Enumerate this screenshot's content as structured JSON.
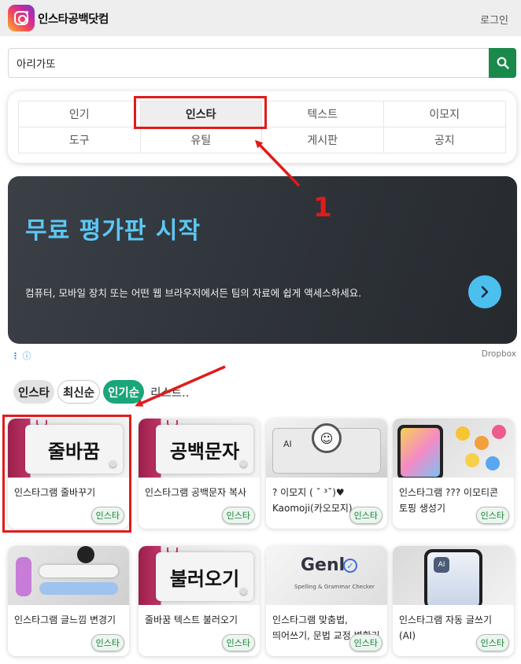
{
  "header": {
    "logo_text": "인스타공백닷컴",
    "login_label": "로그인"
  },
  "search": {
    "value": "아리가또",
    "placeholder": ""
  },
  "menu": {
    "items": [
      {
        "label": "인기"
      },
      {
        "label": "인스타"
      },
      {
        "label": "텍스트"
      },
      {
        "label": "이모지"
      },
      {
        "label": "도구"
      },
      {
        "label": "유틸"
      },
      {
        "label": "게시판"
      },
      {
        "label": "공지"
      }
    ],
    "active_index": 1
  },
  "ad": {
    "title": "무료 평가판 시작",
    "description": "컴퓨터, 모바일 장치 또는 어떤 웹 브라우저에서든 팀의 자료에 쉽게 액세스하세요.",
    "info_glyph": "ⓘ",
    "advertiser": "Dropbox"
  },
  "filters": {
    "chips": [
      {
        "label": "인스타",
        "style": "gray"
      },
      {
        "label": "최신순",
        "style": "outline"
      },
      {
        "label": "인기순",
        "style": "green"
      }
    ],
    "list_label": "리스트.."
  },
  "cards": [
    {
      "title": "인스타그램 줄바꾸기",
      "badge": "인스타",
      "thumb_text": "줄바꿈"
    },
    {
      "title": "인스타그램 공백문자 복사",
      "badge": "인스타",
      "thumb_text": "공백문자"
    },
    {
      "title": "? 이모지 ( ˘ ³˘)♥ Kaomoji(카오모지)",
      "badge": "인스타",
      "thumb_text": "AI"
    },
    {
      "title": "인스타그램 ??? 이모티콘 토핑 생성기",
      "badge": "인스타",
      "thumb_text": ""
    },
    {
      "title": "인스타그램 글느낌 변경기",
      "badge": "인스타",
      "thumb_text": ""
    },
    {
      "title": "줄바꿈 텍스트 불러오기",
      "badge": "인스타",
      "thumb_text": "불러오기"
    },
    {
      "title": "인스타그램 맞춤법, 띄어쓰기, 문법 교정 변환기",
      "badge": "인스타",
      "thumb_text": "Genl"
    },
    {
      "title": "인스타그램 자동 글쓰기 (AI)",
      "badge": "인스타",
      "thumb_text": "AI"
    }
  ],
  "annotations": {
    "step_number": "1",
    "color": "#e11b1b"
  },
  "colors": {
    "search_button": "#1a8a4a",
    "ad_title": "#5bc8f5",
    "ad_background": "#2d3238",
    "chip_active": "#1aa57a",
    "badge_text": "#1a7a3a"
  }
}
